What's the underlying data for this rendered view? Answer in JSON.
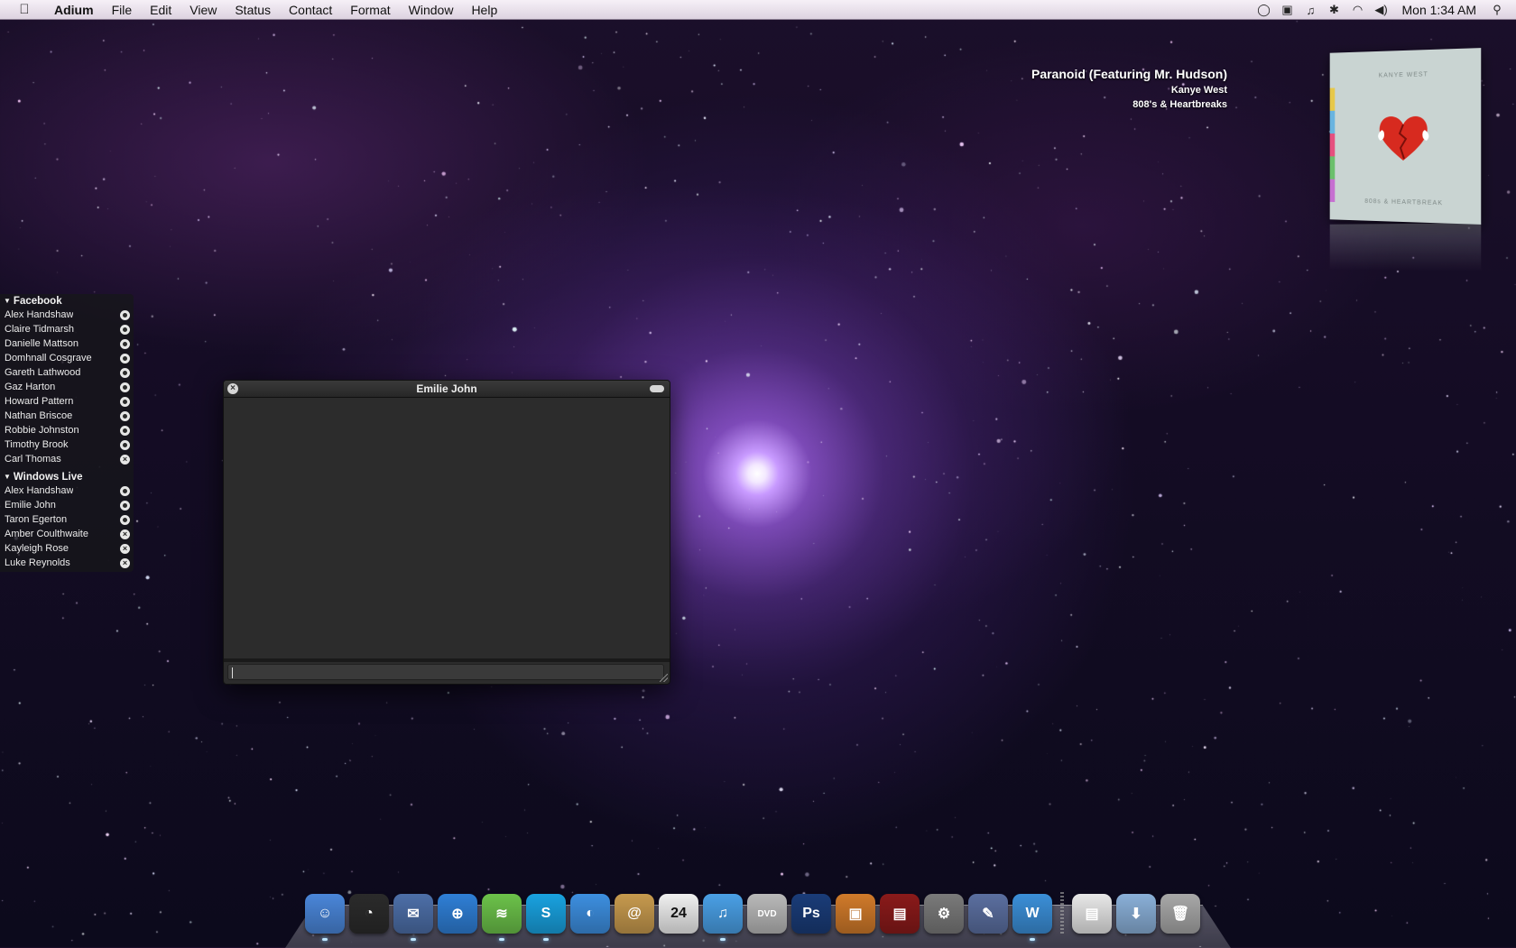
{
  "menubar": {
    "app_name": "Adium",
    "menus": [
      "File",
      "Edit",
      "View",
      "Status",
      "Contact",
      "Format",
      "Window",
      "Help"
    ],
    "status_icons": [
      "adium-status-icon",
      "display-icon",
      "itunes-note-icon",
      "bluetooth-icon",
      "wifi-icon",
      "volume-icon"
    ],
    "clock": "Mon 1:34 AM"
  },
  "now_playing": {
    "title": "Paranoid (Featuring Mr. Hudson)",
    "artist": "Kanye West",
    "album": "808's & Heartbreaks",
    "cover_top_text": "KANYE WEST",
    "cover_bottom_text": "808s & HEARTBREAK"
  },
  "contact_list": {
    "groups": [
      {
        "name": "Facebook",
        "contacts": [
          {
            "name": "Alex Handshaw",
            "status": "available"
          },
          {
            "name": "Claire Tidmarsh",
            "status": "available"
          },
          {
            "name": "Danielle Mattson",
            "status": "available"
          },
          {
            "name": "Domhnall Cosgrave",
            "status": "available"
          },
          {
            "name": "Gareth Lathwood",
            "status": "available"
          },
          {
            "name": "Gaz Harton",
            "status": "available"
          },
          {
            "name": "Howard Pattern",
            "status": "available"
          },
          {
            "name": "Nathan Briscoe",
            "status": "available"
          },
          {
            "name": "Robbie Johnston",
            "status": "available"
          },
          {
            "name": "Timothy Brook",
            "status": "available"
          },
          {
            "name": "Carl Thomas",
            "status": "offline"
          }
        ]
      },
      {
        "name": "Windows Live",
        "contacts": [
          {
            "name": "Alex Handshaw",
            "status": "available"
          },
          {
            "name": "Emilie John",
            "status": "available"
          },
          {
            "name": "Taron Egerton",
            "status": "available"
          },
          {
            "name": "Amber Coulthwaite",
            "status": "offline"
          },
          {
            "name": "Kayleigh Rose",
            "status": "offline"
          },
          {
            "name": "Luke Reynolds",
            "status": "offline"
          }
        ]
      }
    ]
  },
  "chat_window": {
    "title": "Emilie John",
    "input_value": ""
  },
  "dock": {
    "apps": [
      {
        "name": "finder",
        "color": "#4a86d9",
        "label": "☺",
        "running": true
      },
      {
        "name": "dashboard",
        "color": "#2b2b2b",
        "label": "◔",
        "running": false
      },
      {
        "name": "mail",
        "color": "#4d6fa8",
        "label": "✉",
        "running": true
      },
      {
        "name": "safari",
        "color": "#2f7fd6",
        "label": "⊕",
        "running": false
      },
      {
        "name": "spotify",
        "color": "#6cc24a",
        "label": "≋",
        "running": true
      },
      {
        "name": "skype",
        "color": "#19a2e0",
        "label": "S",
        "running": true
      },
      {
        "name": "ichat",
        "color": "#3d8fe0",
        "label": "◐",
        "running": false
      },
      {
        "name": "address-book",
        "color": "#c79a4e",
        "label": "@",
        "running": false
      },
      {
        "name": "ical",
        "color": "#f0f0f0",
        "label": "24",
        "running": false
      },
      {
        "name": "itunes",
        "color": "#4aa0e6",
        "label": "♫",
        "running": true
      },
      {
        "name": "dvd-player",
        "color": "#b9b9b9",
        "label": "DVD",
        "running": false
      },
      {
        "name": "photoshop",
        "color": "#1a3c78",
        "label": "Ps",
        "running": false
      },
      {
        "name": "iphoto",
        "color": "#d07a2a",
        "label": "▣",
        "running": false
      },
      {
        "name": "front-row",
        "color": "#8a1a1a",
        "label": "▤",
        "running": false
      },
      {
        "name": "system-preferences",
        "color": "#7a7a7a",
        "label": "⚙",
        "running": false
      },
      {
        "name": "script-editor",
        "color": "#5b6fa0",
        "label": "✎",
        "running": false
      },
      {
        "name": "adium",
        "color": "#3b8fd8",
        "label": "W",
        "running": true
      }
    ],
    "folders": [
      {
        "name": "documents",
        "color": "#e8e8e8",
        "label": "▤"
      },
      {
        "name": "downloads",
        "color": "#8ab0d8",
        "label": "⬇"
      },
      {
        "name": "trash",
        "color": "#a8a8a8",
        "label": "🗑"
      }
    ]
  }
}
